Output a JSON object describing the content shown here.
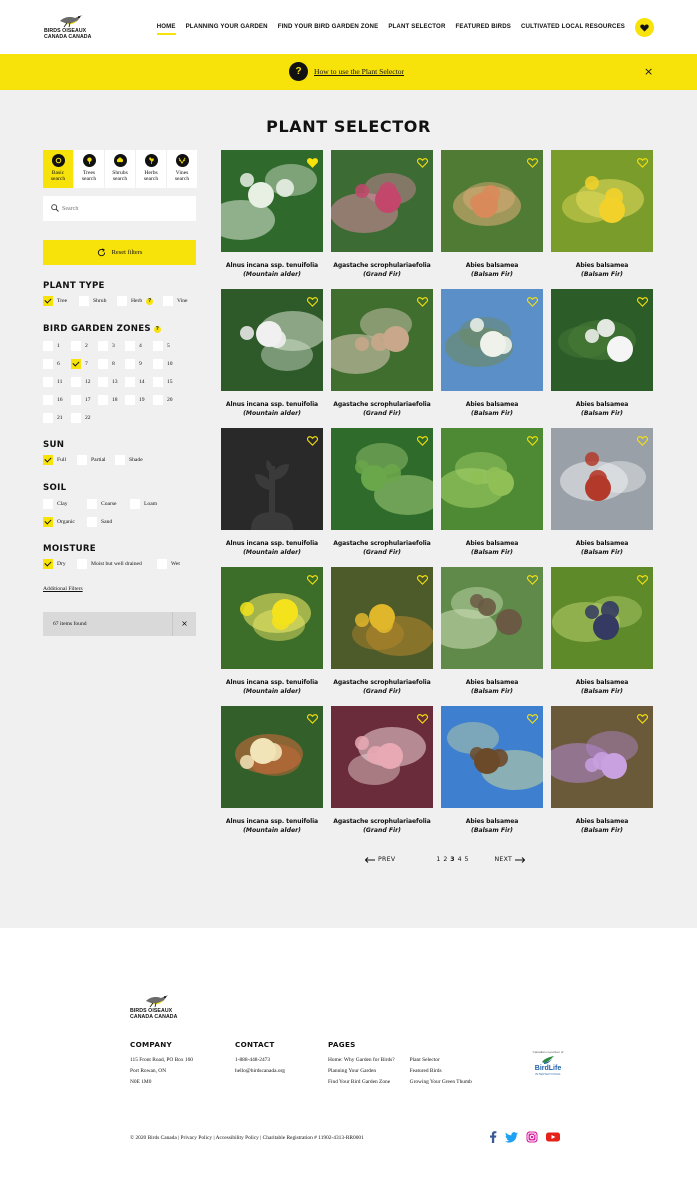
{
  "header": {
    "logo": {
      "line1": "BIRDS OISEAUX",
      "line2": "CANADA CANADA"
    },
    "nav": [
      "HOME",
      "PLANNING YOUR GARDEN",
      "FIND YOUR BIRD GARDEN ZONE",
      "PLANT SELECTOR",
      "FEATURED BIRDS",
      "CULTIVATED LOCAL RESOURCES"
    ],
    "active_nav": "HOME",
    "favorites_icon": "heart-icon"
  },
  "banner": {
    "link": "How to use the Plant Selector",
    "icon": "question-icon",
    "close": "×"
  },
  "page_title": "PLANT SELECTOR",
  "tabs": [
    {
      "label1": "Basic",
      "label2": "search",
      "icon": "circle-leaf-icon",
      "active": true
    },
    {
      "label1": "Trees",
      "label2": "search",
      "icon": "tree-icon",
      "active": false
    },
    {
      "label1": "Shrubs",
      "label2": "search",
      "icon": "shrub-icon",
      "active": false
    },
    {
      "label1": "Herbs",
      "label2": "search",
      "icon": "herb-icon",
      "active": false
    },
    {
      "label1": "Vines",
      "label2": "search",
      "icon": "vine-icon",
      "active": false
    }
  ],
  "search": {
    "placeholder": "Search"
  },
  "reset": "Reset filters",
  "filters": {
    "plant_type": {
      "title": "PLANT TYPE",
      "options": [
        "Tree",
        "Shrub",
        "Herb",
        "Vine"
      ]
    },
    "zones": {
      "title": "BIRD GARDEN ZONES",
      "options": [
        "1",
        "2",
        "3",
        "4",
        "5",
        "6",
        "7",
        "8",
        "9",
        "10",
        "11",
        "12",
        "13",
        "14",
        "15",
        "16",
        "17",
        "18",
        "19",
        "20",
        "21",
        "22"
      ]
    },
    "sun": {
      "title": "SUN",
      "options": [
        "Full",
        "Partial",
        "Shade"
      ]
    },
    "soil": {
      "title": "SOIL",
      "options": [
        "Clay",
        "Coarse",
        "Loam",
        "Organic",
        "Sand"
      ]
    },
    "moisture": {
      "title": "MOISTURE",
      "options": [
        "Dry",
        "Moist but well drained",
        "Wet"
      ]
    }
  },
  "additional_filters": "Additional Filters",
  "items_found": "67 items found",
  "items_close": "×",
  "plants": [
    {
      "sci": "Alnus incana ssp. tenuifolia",
      "common": "(Mountain alder)"
    },
    {
      "sci": "Agastache scrophulariaefolia",
      "common": "(Grand Fir)"
    },
    {
      "sci": "Abies balsamea",
      "common": "(Balsam Fir)"
    },
    {
      "sci": "Abies balsamea",
      "common": "(Balsam Fir)"
    }
  ],
  "pager": {
    "prev": "PREV",
    "next": "NEXT",
    "pages": [
      "1",
      "2",
      "3",
      "4",
      "5"
    ],
    "current": "3"
  },
  "footer": {
    "logo": {
      "line1": "BIRDS OISEAUX",
      "line2": "CANADA CANADA"
    },
    "company": {
      "title": "COMPANY",
      "lines": [
        "115 Front Road, PO Box 160",
        "Port Rowan, ON",
        "N0E 1M0"
      ]
    },
    "contact": {
      "title": "CONTACT",
      "lines": [
        "1-888-448-2473",
        "hello@birdscanada.org"
      ]
    },
    "pages": {
      "title": "PAGES",
      "col1": [
        "Home: Why Garden for Birds?",
        "Planning Your Garden",
        "Find Your Bird Garden Zone"
      ],
      "col2": [
        "Plant Selector",
        "Featured Birds",
        "Growing Your Green Thumb"
      ]
    },
    "partner": {
      "line1": "Canadian co-partner of",
      "line2": "BirdLife",
      "line3": "INTERNATIONAL"
    },
    "copyright": "© 2020 Birds Canada | Privacy Policy | Accessibility Policy | Charitable Registration # 11902-4313-RR0001",
    "social_icons": [
      "facebook-icon",
      "twitter-icon",
      "instagram-icon",
      "youtube-icon"
    ]
  },
  "colors": {
    "accent": "#f7e20a",
    "page_bg": "#f0f0f0",
    "text": "#111111"
  }
}
